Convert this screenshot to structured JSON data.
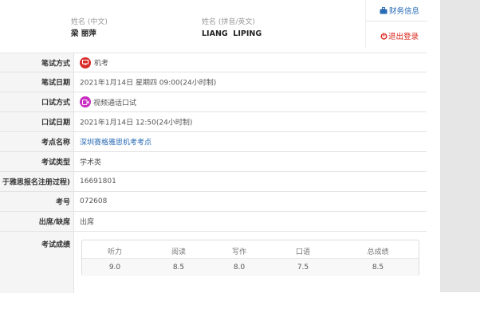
{
  "header": {
    "name_cn_label": "姓名 (中文)",
    "name_cn_value": "梁 丽萍",
    "name_en_label": "姓名 (拼音/英文)",
    "name_en_value": "LIANG  LIPING"
  },
  "links": {
    "finance_label": "财务信息",
    "logout_label": "退出登录"
  },
  "rows": [
    {
      "label": "笔试方式",
      "value": "机考"
    },
    {
      "label": "笔试日期",
      "value": "2021年1月14日 星期四 09:00(24小时制)"
    },
    {
      "label": "口试方式",
      "value": "视频通话口试"
    },
    {
      "label": "口试日期",
      "value": "2021年1月14日 12:50(24小时制)"
    },
    {
      "label": "考点名称",
      "value": "深圳赛格雅思机考考点"
    },
    {
      "label": "考试类型",
      "value": "学术类"
    },
    {
      "label": "于雅思报名注册过程)",
      "value": "16691801"
    },
    {
      "label": "考号",
      "value": "072608"
    },
    {
      "label": "出席/缺席",
      "value": "出席"
    },
    {
      "label": "考试成绩",
      "value": ""
    }
  ],
  "scores": {
    "headers": [
      "听力",
      "阅读",
      "写作",
      "口语",
      "总成绩"
    ],
    "values": [
      "9.0",
      "8.5",
      "8.0",
      "7.5",
      "8.5"
    ]
  },
  "colors": {
    "link": "#2a6bb5",
    "logout": "#d9261c",
    "computer_icon": "#d92a2a",
    "video_icon": "#c82dc0"
  }
}
